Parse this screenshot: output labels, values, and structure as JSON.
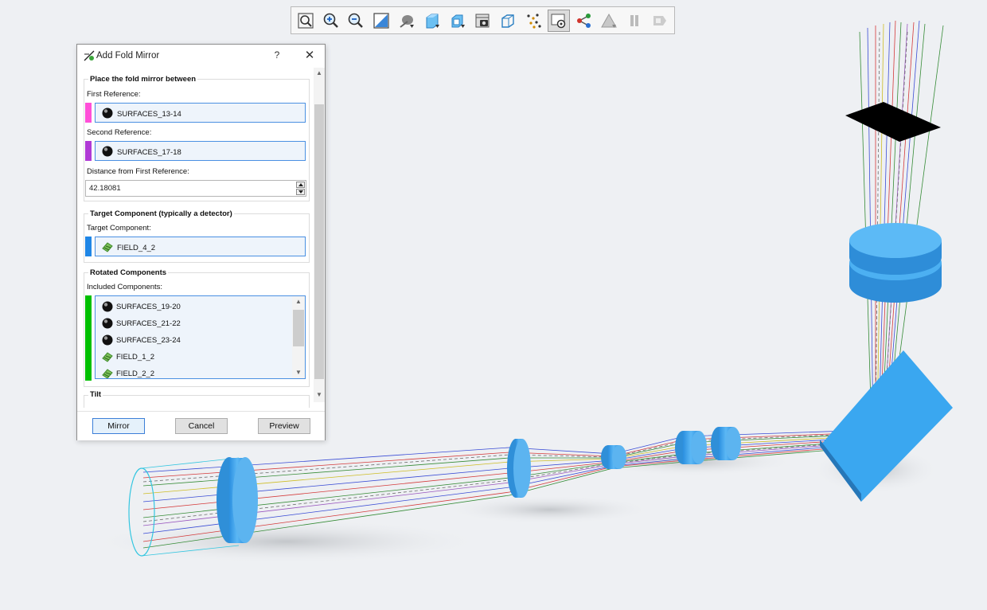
{
  "toolbar": {
    "buttons": [
      {
        "name": "zoom-fit-icon"
      },
      {
        "name": "zoom-in-icon"
      },
      {
        "name": "zoom-out-icon"
      },
      {
        "name": "zoom-window-icon"
      },
      {
        "name": "shading-icon"
      },
      {
        "name": "solid-view-icon"
      },
      {
        "name": "export-view-icon"
      },
      {
        "name": "screenshot-icon"
      },
      {
        "name": "wireframe-icon"
      },
      {
        "name": "ray-points-icon"
      },
      {
        "name": "rotate-view-icon",
        "active": true
      },
      {
        "name": "layout-tree-icon"
      },
      {
        "name": "alert-icon"
      },
      {
        "name": "pause-icon"
      },
      {
        "name": "stop-icon"
      }
    ]
  },
  "dialog": {
    "title": "Add Fold Mirror",
    "help": "?",
    "close": "✕",
    "placement": {
      "group_title": "Place the fold mirror between",
      "first_label": "First Reference:",
      "first_value": "SURFACES_13-14",
      "second_label": "Second Reference:",
      "second_value": "SURFACES_17-18",
      "distance_label": "Distance from First Reference:",
      "distance_value": "42.18081"
    },
    "target": {
      "group_title": "Target Component (typically a detector)",
      "label": "Target Component:",
      "value": "FIELD_4_2"
    },
    "rotated": {
      "group_title": "Rotated Components",
      "label": "Included Components:",
      "items": [
        "SURFACES_19-20",
        "SURFACES_21-22",
        "SURFACES_23-24",
        "FIELD_1_2",
        "FIELD_2_2"
      ]
    },
    "tilt": {
      "group_title": "Tilt"
    },
    "buttons": {
      "mirror": "Mirror",
      "cancel": "Cancel",
      "preview": "Preview"
    }
  },
  "colors": {
    "first_ref": "#ff4fd8",
    "second_ref": "#b03ad6",
    "target": "#1f86e6",
    "rotated": "#00c000",
    "component_blue": "#3aa7f0"
  }
}
